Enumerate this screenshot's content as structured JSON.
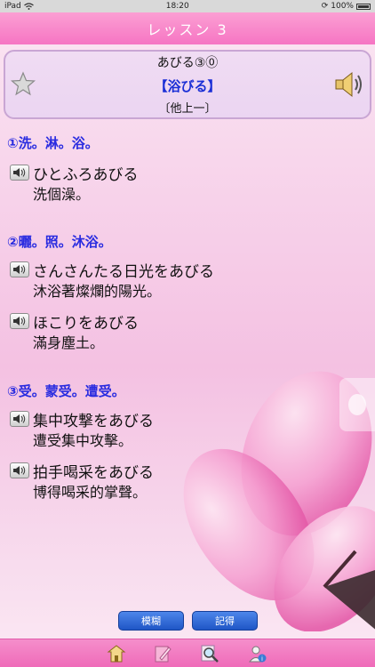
{
  "status_bar": {
    "device": "iPad",
    "time": "18:20",
    "battery": "100%"
  },
  "nav": {
    "title": "レッスン 3"
  },
  "card": {
    "reading": "あびる③⓪",
    "kanji": "【浴びる】",
    "verb_type": "〔他上一〕"
  },
  "meanings": [
    {
      "heading": "①洗。淋。浴。",
      "examples": [
        {
          "jp": "ひとふろあびる",
          "zh": "洗個澡。"
        }
      ]
    },
    {
      "heading": "②曬。照。沐浴。",
      "examples": [
        {
          "jp": "さんさんたる日光をあびる",
          "zh": "沐浴著燦爛的陽光。"
        },
        {
          "jp": "ほこりをあびる",
          "zh": "滿身塵土。"
        }
      ]
    },
    {
      "heading": "③受。蒙受。遭受。",
      "examples": [
        {
          "jp": "集中攻撃をあびる",
          "zh": "遭受集中攻擊。"
        },
        {
          "jp": "拍手喝采をあびる",
          "zh": "博得喝采的掌聲。"
        }
      ]
    }
  ],
  "buttons": {
    "vague": "模糊",
    "remember": "記得"
  },
  "tabs": [
    "home-icon",
    "edit-icon",
    "search-icon",
    "info-icon"
  ],
  "colors": {
    "accent": "#f675c3",
    "heading": "#2a2ce0",
    "button": "#2a64d6"
  }
}
